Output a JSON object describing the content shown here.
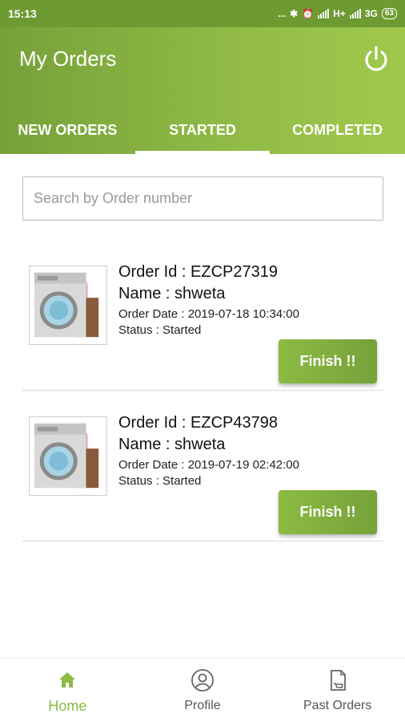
{
  "statusbar": {
    "time": "15:13",
    "dots": "...",
    "network1": "H+",
    "network2": "3G",
    "battery": "63"
  },
  "appbar": {
    "title": "My Orders",
    "tabs": [
      {
        "label": "NEW ORDERS",
        "active": false
      },
      {
        "label": "STARTED",
        "active": true
      },
      {
        "label": "COMPLETED",
        "active": false
      }
    ]
  },
  "search": {
    "placeholder": "Search by Order number",
    "value": ""
  },
  "orders": [
    {
      "order_id": "Order Id : EZCP27319",
      "name": "Name : shweta",
      "order_date": "Order Date : 2019-07-18 10:34:00",
      "status": "Status : Started",
      "action": "Finish !!"
    },
    {
      "order_id": "Order Id : EZCP43798",
      "name": "Name : shweta",
      "order_date": "Order Date : 2019-07-19 02:42:00",
      "status": "Status : Started",
      "action": "Finish !!"
    }
  ],
  "bottomnav": {
    "items": [
      {
        "label": "Home",
        "icon": "home-icon",
        "active": true
      },
      {
        "label": "Profile",
        "icon": "profile-icon",
        "active": false
      },
      {
        "label": "Past Orders",
        "icon": "past-orders-icon",
        "active": false
      }
    ]
  },
  "colors": {
    "accent": "#8cbb44",
    "appbar_dark": "#76a13a",
    "statusbar": "#6e9a32"
  }
}
